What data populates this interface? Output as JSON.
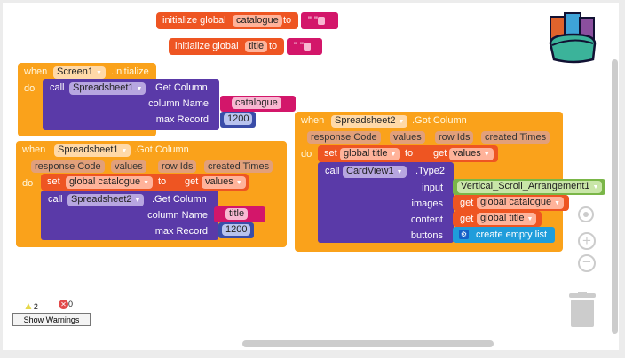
{
  "globals": [
    {
      "label": "initialize global",
      "name": "catalogue",
      "to": "to",
      "value": "\" \""
    },
    {
      "label": "initialize global",
      "name": "title",
      "to": "to",
      "value": "\" \""
    }
  ],
  "screen_init": {
    "when": "when",
    "component": "Screen1",
    "event": ".Initialize",
    "do": "do",
    "call": "call",
    "target": "Spreadsheet1",
    "method": ".Get Column",
    "arg1": "column Name",
    "arg1_value": "catalogue",
    "arg2": "max Record",
    "arg2_value": "1200"
  },
  "ss1": {
    "when": "when",
    "component": "Spreadsheet1",
    "event": ".Got Column",
    "params": [
      "response Code",
      "values",
      "row Ids",
      "created Times"
    ],
    "do": "do",
    "set": "set",
    "set_var": "global catalogue",
    "to": "to",
    "get": "get",
    "get_var": "values",
    "call": "call",
    "target": "Spreadsheet2",
    "method": ".Get Column",
    "arg1": "column Name",
    "arg1_value": "title",
    "arg2": "max Record",
    "arg2_value": "1200"
  },
  "ss2": {
    "when": "when",
    "component": "Spreadsheet2",
    "event": ".Got Column",
    "params": [
      "response Code",
      "values",
      "row Ids",
      "created Times"
    ],
    "do": "do",
    "set": "set",
    "set_var": "global title",
    "to": "to",
    "get": "get",
    "get_var": "values",
    "call": "call",
    "target": "CardView1",
    "method": ".Type2",
    "input": "input",
    "input_value": "Vertical_Scroll_Arrangement1",
    "images": "images",
    "images_get": "get",
    "images_var": "global catalogue",
    "content": "content",
    "content_get": "get",
    "content_var": "global title",
    "buttons": "buttons",
    "buttons_value": "create empty list"
  },
  "warnings": {
    "warning_count": "2",
    "error_count": "0",
    "button": "Show Warnings"
  },
  "colors": {
    "event": "#faa21b",
    "variable": "#ee5522",
    "procedure": "#5a3aa8",
    "text": "#d3166a",
    "math": "#3a4da8",
    "component": "#7ab648",
    "list": "#1f9ddb"
  }
}
